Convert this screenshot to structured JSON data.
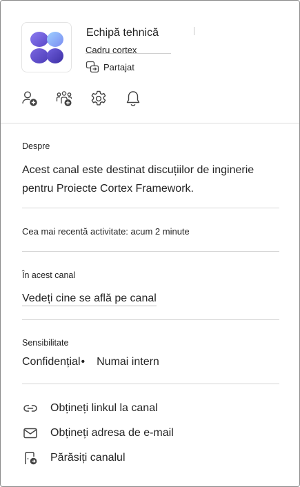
{
  "header": {
    "team_name": "Echipă tehnică",
    "parent_team": "Cadru cortex",
    "shared_label": "Partajat",
    "logo_colors": [
      "#6a5ad1",
      "#8e8ef0",
      "#7d6ae0",
      "#4b3fb5"
    ]
  },
  "actions": [
    {
      "icon": "add-person-icon"
    },
    {
      "icon": "team-add-icon"
    },
    {
      "icon": "gear-icon"
    },
    {
      "icon": "bell-icon"
    }
  ],
  "about": {
    "label": "Despre",
    "description": "Acest canal este destinat discuțiilor de inginerie pentru Proiecte Cortex Framework."
  },
  "activity": {
    "text": "Cea mai recentă activitate: acum 2 minute"
  },
  "in_channel": {
    "label": "În acest canal",
    "link": "Vedeți cine se află pe canal"
  },
  "sensitivity": {
    "label": "Sensibilitate",
    "value": "Confidențial",
    "separator": "•",
    "detail": "Numai intern"
  },
  "menu": {
    "get_link": "Obțineți linkul la canal",
    "get_email": "Obțineți adresa de e-mail",
    "leave": "Părăsiți canalul"
  }
}
